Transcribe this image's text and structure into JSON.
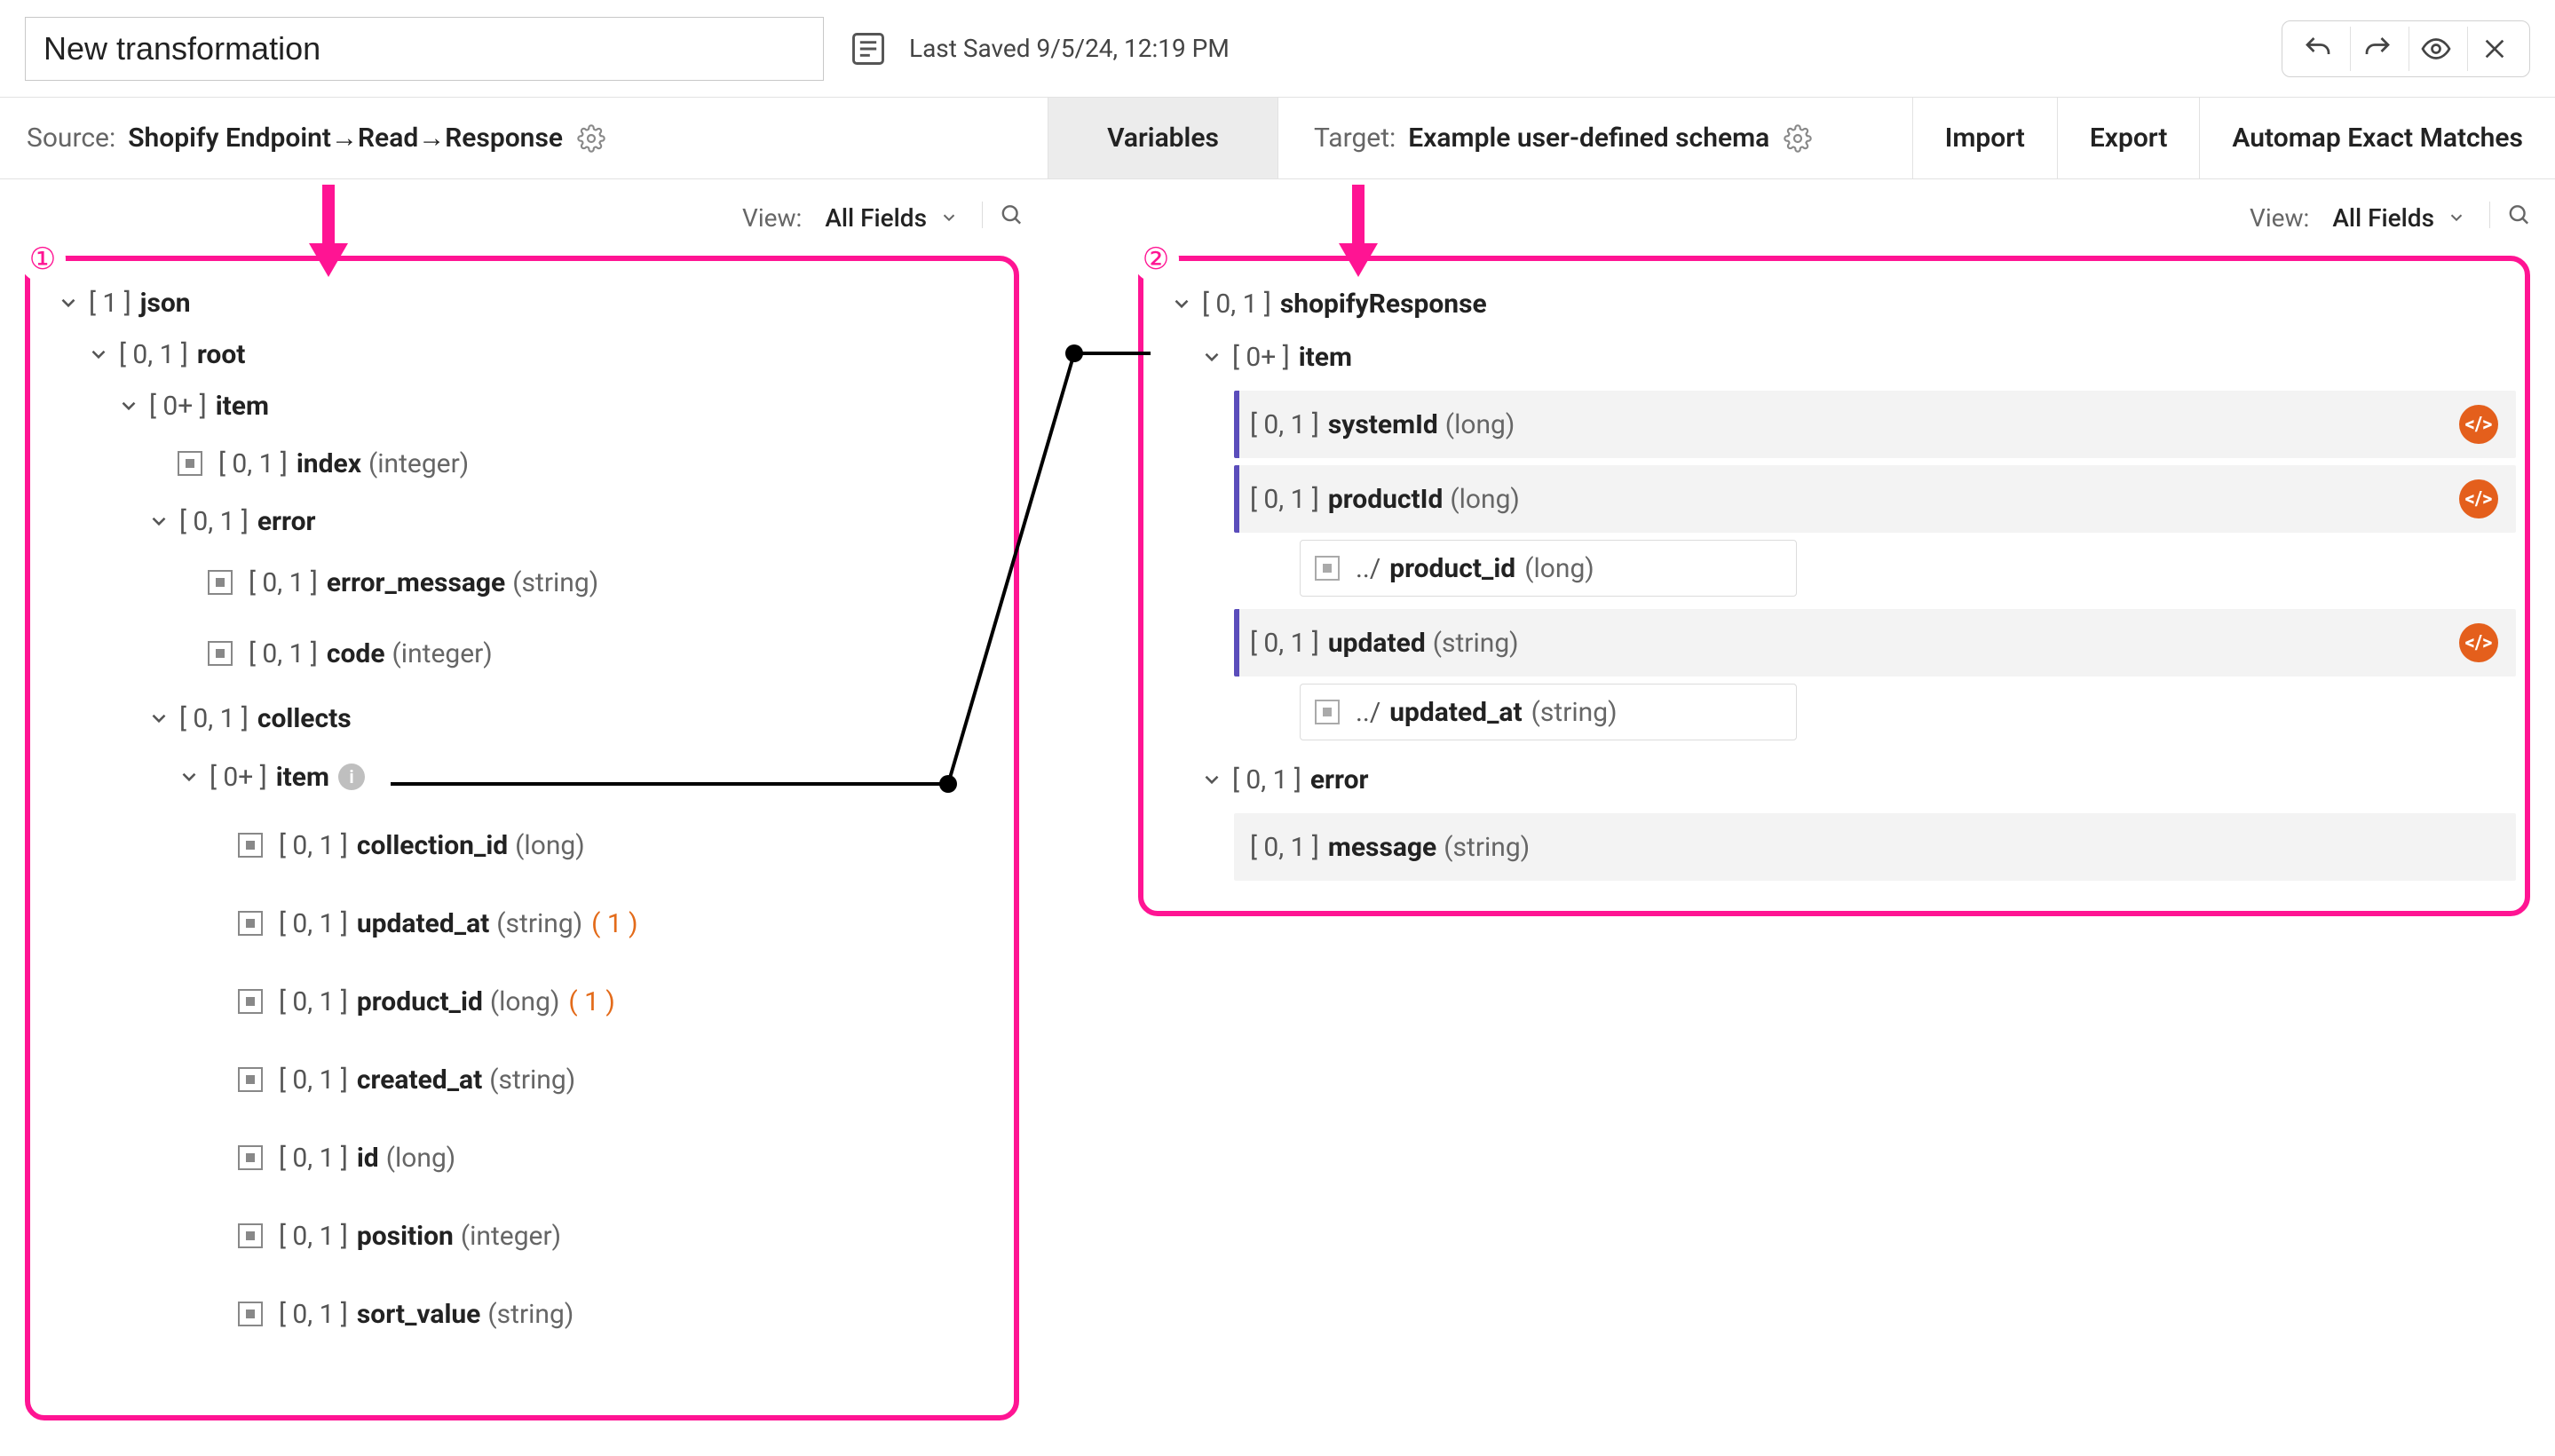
{
  "header": {
    "title_value": "New transformation",
    "last_saved": "Last Saved 9/5/24, 12:19 PM"
  },
  "toolbar": {
    "source_label": "Source:",
    "source_path": "Shopify Endpoint→Read→Response",
    "variables_tab": "Variables",
    "target_label": "Target:",
    "target_path": "Example user-defined schema",
    "import_btn": "Import",
    "export_btn": "Export",
    "automap_btn": "Automap Exact Matches"
  },
  "view": {
    "label": "View:",
    "selection": "All Fields"
  },
  "annotations": {
    "badge1": "①",
    "badge2": "②"
  },
  "source_tree": {
    "root_card": "[ 1 ]",
    "root_name": "json",
    "n1_card": "[ 0, 1 ]",
    "n1_name": "root",
    "n2_card": "[ 0+ ]",
    "n2_name": "item",
    "l_index_card": "[ 0, 1 ]",
    "l_index_name": "index",
    "l_index_type": "(integer)",
    "n_error_card": "[ 0, 1 ]",
    "n_error_name": "error",
    "l_errmsg_card": "[ 0, 1 ]",
    "l_errmsg_name": "error_message",
    "l_errmsg_type": "(string)",
    "l_code_card": "[ 0, 1 ]",
    "l_code_name": "code",
    "l_code_type": "(integer)",
    "n_collects_card": "[ 0, 1 ]",
    "n_collects_name": "collects",
    "n_citem_card": "[ 0+ ]",
    "n_citem_name": "item",
    "l_colid_card": "[ 0, 1 ]",
    "l_colid_name": "collection_id",
    "l_colid_type": "(long)",
    "l_upd_card": "[ 0, 1 ]",
    "l_upd_name": "updated_at",
    "l_upd_type": "(string)",
    "l_upd_cnt": "( 1 )",
    "l_prod_card": "[ 0, 1 ]",
    "l_prod_name": "product_id",
    "l_prod_type": "(long)",
    "l_prod_cnt": "( 1 )",
    "l_cre_card": "[ 0, 1 ]",
    "l_cre_name": "created_at",
    "l_cre_type": "(string)",
    "l_id_card": "[ 0, 1 ]",
    "l_id_name": "id",
    "l_id_type": "(long)",
    "l_pos_card": "[ 0, 1 ]",
    "l_pos_name": "position",
    "l_pos_type": "(integer)",
    "l_sort_card": "[ 0, 1 ]",
    "l_sort_name": "sort_value",
    "l_sort_type": "(string)"
  },
  "target_tree": {
    "root_card": "[ 0, 1 ]",
    "root_name": "shopifyResponse",
    "item_card": "[ 0+ ]",
    "item_name": "item",
    "f_sys_card": "[ 0, 1 ]",
    "f_sys_name": "systemId",
    "f_sys_type": "(long)",
    "f_prod_card": "[ 0, 1 ]",
    "f_prod_name": "productId",
    "f_prod_type": "(long)",
    "m_prod_path": "../",
    "m_prod_name": "product_id",
    "m_prod_type": "(long)",
    "f_upd_card": "[ 0, 1 ]",
    "f_upd_name": "updated",
    "f_upd_type": "(string)",
    "m_upd_path": "../",
    "m_upd_name": "updated_at",
    "m_upd_type": "(string)",
    "err_card": "[ 0, 1 ]",
    "err_name": "error",
    "f_msg_card": "[ 0, 1 ]",
    "f_msg_name": "message",
    "f_msg_type": "(string)",
    "script_badge_glyph": "</>"
  }
}
